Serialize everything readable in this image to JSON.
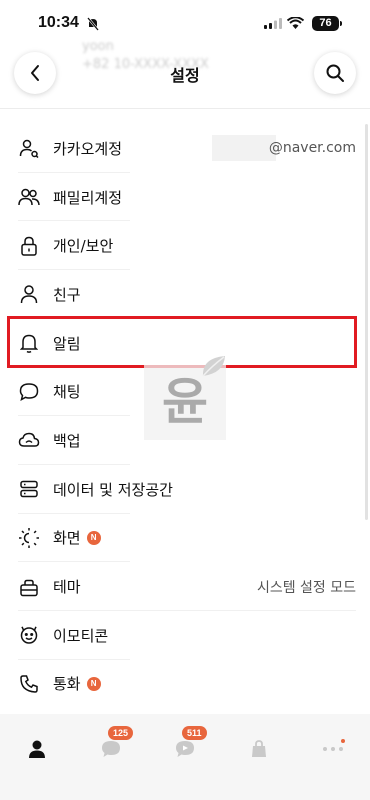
{
  "status_bar": {
    "time": "10:34",
    "battery": "76"
  },
  "header": {
    "title": "설정",
    "blurred_name": "yoon",
    "blurred_phone": "+82 10-XXXX-XXXX"
  },
  "menu": [
    {
      "label": "카카오계정",
      "value": "@naver.com",
      "icon": "account-icon"
    },
    {
      "label": "패밀리계정",
      "icon": "family-icon"
    },
    {
      "label": "개인/보안",
      "icon": "lock-icon"
    },
    {
      "label": "친구",
      "icon": "person-icon"
    },
    {
      "label": "알림",
      "icon": "bell-icon"
    },
    {
      "label": "채팅",
      "icon": "chat-bubble-icon"
    },
    {
      "label": "백업",
      "icon": "cloud-icon"
    },
    {
      "label": "데이터 및 저장공간",
      "icon": "storage-icon"
    },
    {
      "label": "화면",
      "badge": "N",
      "icon": "brightness-icon"
    },
    {
      "label": "테마",
      "value": "시스템 설정 모드",
      "icon": "theme-icon"
    },
    {
      "label": "이모티콘",
      "icon": "emoticon-icon"
    },
    {
      "label": "통화",
      "badge": "N",
      "icon": "phone-icon"
    }
  ],
  "watermark": {
    "text": "윤"
  },
  "tabbar": {
    "chats_badge": "125",
    "openchat_badge": "511"
  },
  "colors": {
    "highlight": "#e11b22",
    "badge": "#e8663d"
  }
}
